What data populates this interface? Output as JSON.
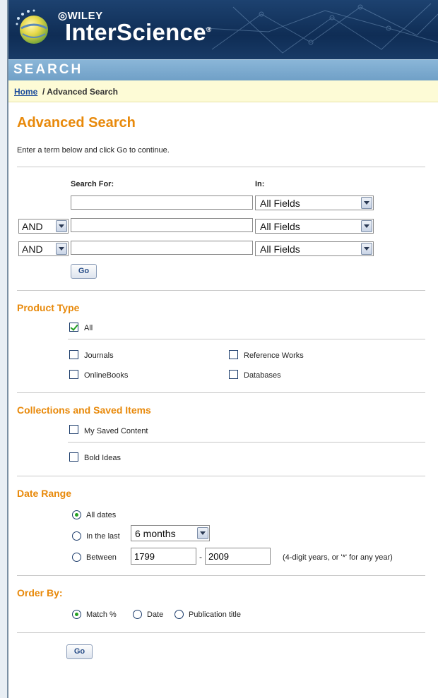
{
  "header": {
    "wiley": "WILEY",
    "brand": "InterScience",
    "reg": "®"
  },
  "searchbar": {
    "label": "SEARCH"
  },
  "breadcrumb": {
    "home": "Home",
    "current": " / Advanced Search"
  },
  "page": {
    "title": "Advanced Search",
    "intro": "Enter a term below and click Go to continue."
  },
  "search_form": {
    "search_for_label": "Search For:",
    "in_label": "In:",
    "rows": [
      {
        "operator": "",
        "term": "",
        "field": "All Fields"
      },
      {
        "operator": "AND",
        "term": "",
        "field": "All Fields"
      },
      {
        "operator": "AND",
        "term": "",
        "field": "All Fields"
      }
    ],
    "go_label": "Go"
  },
  "product_type": {
    "heading": "Product Type",
    "all_label": "All",
    "all_checked": true,
    "options": [
      {
        "label": "Journals",
        "checked": false
      },
      {
        "label": "Reference Works",
        "checked": false
      },
      {
        "label": "OnlineBooks",
        "checked": false
      },
      {
        "label": "Databases",
        "checked": false
      }
    ]
  },
  "collections": {
    "heading": "Collections and Saved Items",
    "options": [
      {
        "label": "My Saved Content",
        "checked": false
      },
      {
        "label": "Bold Ideas",
        "checked": false
      }
    ]
  },
  "date_range": {
    "heading": "Date Range",
    "all_dates_label": "All dates",
    "in_the_last_label": "In the last",
    "in_the_last_value": "6 months",
    "between_label": "Between",
    "from_year": "1799",
    "dash": "-",
    "to_year": "2009",
    "hint": "(4-digit years, or '*' for any year)",
    "selected": "All dates"
  },
  "order_by": {
    "heading": "Order By:",
    "options": [
      "Match %",
      "Date",
      "Publication title"
    ],
    "selected": "Match %"
  },
  "bottom_go_label": "Go",
  "colors": {
    "accent": "#e8890a",
    "header": "#183a66",
    "searchbar": "#7aaad0",
    "crumb_bg": "#fdfbd6"
  }
}
